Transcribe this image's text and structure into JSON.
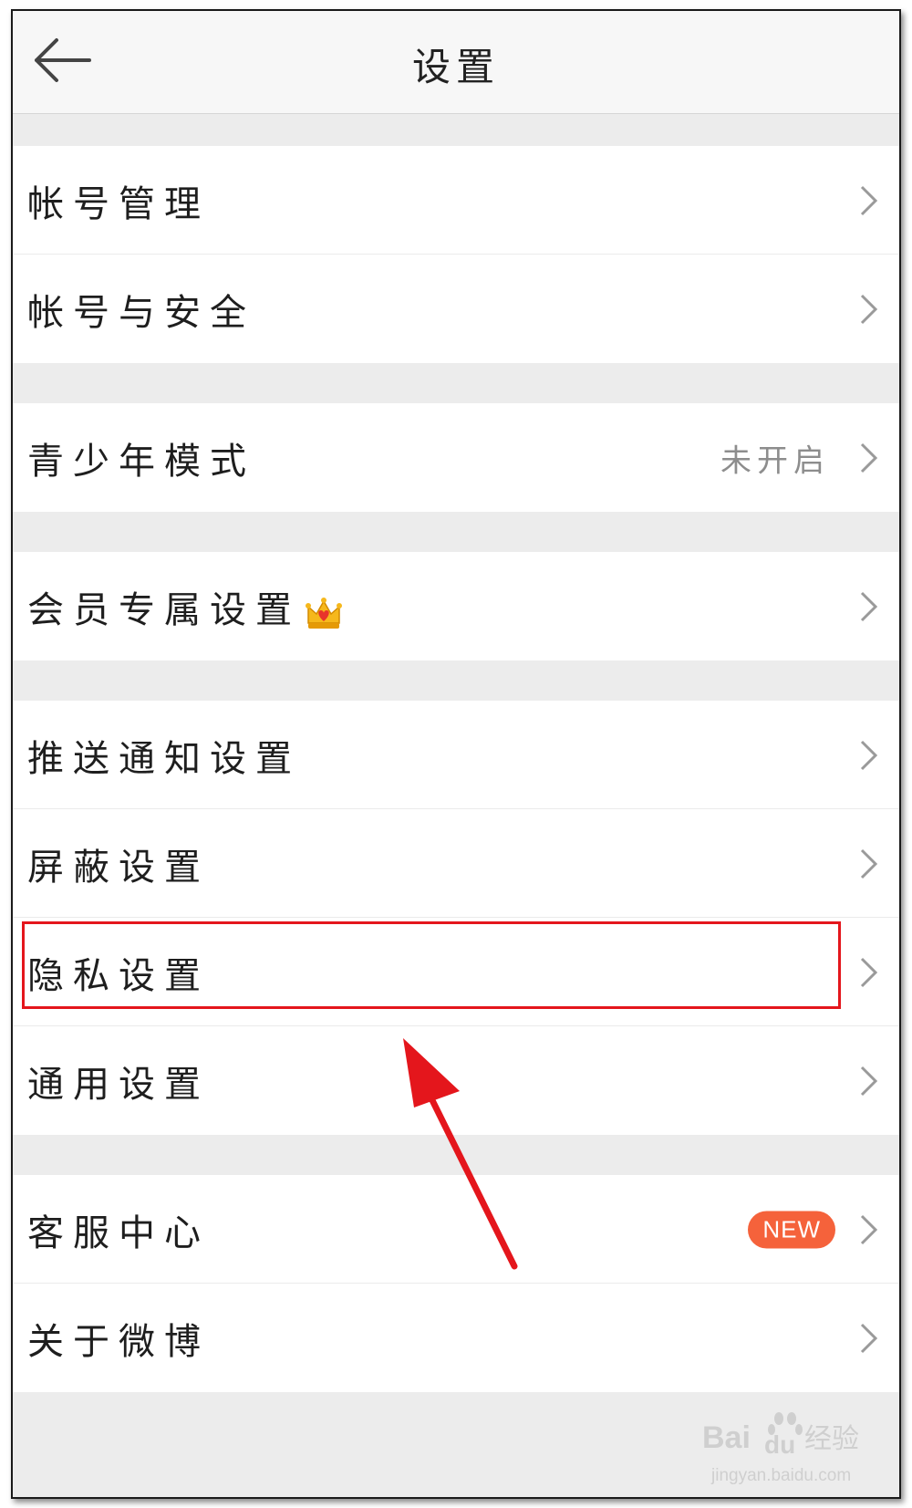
{
  "header": {
    "title": "设置",
    "back_icon": "arrow-left-icon"
  },
  "groups": [
    {
      "items": [
        {
          "label": "帐号管理"
        },
        {
          "label": "帐号与安全"
        }
      ]
    },
    {
      "items": [
        {
          "label": "青少年模式",
          "status": "未开启"
        }
      ]
    },
    {
      "items": [
        {
          "label": "会员专属设置",
          "icon": "crown-icon"
        }
      ]
    },
    {
      "items": [
        {
          "label": "推送通知设置"
        },
        {
          "label": "屏蔽设置"
        },
        {
          "label": "隐私设置"
        },
        {
          "label": "通用设置"
        }
      ]
    },
    {
      "items": [
        {
          "label": "客服中心",
          "badge": "NEW"
        },
        {
          "label": "关于微博"
        }
      ]
    }
  ],
  "annotation": {
    "highlight_color": "#e4161c",
    "highlighted_item": "隐私设置"
  },
  "watermark": {
    "brand": "Bai",
    "paw": "du",
    "cn": "经验",
    "url": "jingyan.baidu.com"
  },
  "colors": {
    "badge": "#f5623b",
    "status_text": "#8d8d8d",
    "background": "#ececec"
  }
}
